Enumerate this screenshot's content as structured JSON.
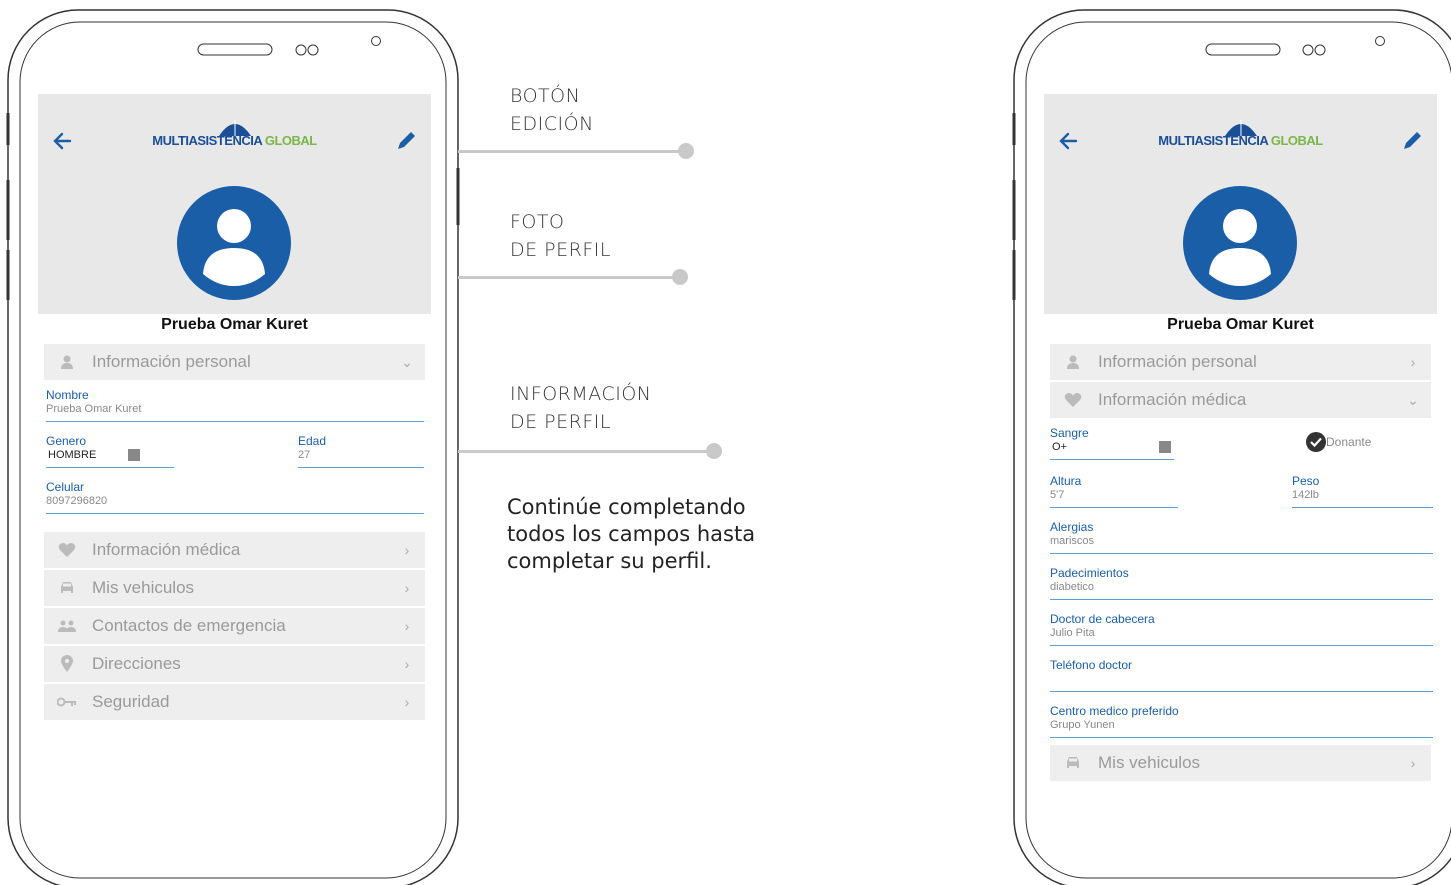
{
  "colors": {
    "brand_blue": "#1a5ea8",
    "brand_green": "#7ab648",
    "menu_bg": "#eeeeee",
    "header_bg": "#e8e8e8",
    "field_line": "#5aa0d8"
  },
  "logo": {
    "part1": "MULTIASISTENCIA",
    "part2": " GLOBAL"
  },
  "callouts": {
    "edit": [
      "BOTÓN",
      "EDICIÓN"
    ],
    "photo": [
      "FOTO",
      "DE PERFIL"
    ],
    "info": [
      "INFORMACIÓN",
      "DE PERFIL"
    ],
    "description": "Continúe completando todos los campos hasta completar su perfil."
  },
  "left_screen": {
    "profile_name": "Prueba Omar Kuret",
    "personal_section": {
      "icon": "person-icon",
      "label": "Información personal",
      "chevron": "chevron-down-icon"
    },
    "fields": {
      "nombre": {
        "label": "Nombre",
        "value": "Prueba Omar Kuret"
      },
      "genero": {
        "label": "Genero",
        "value": "HOMBRE"
      },
      "edad": {
        "label": "Edad",
        "value": "27"
      },
      "celular": {
        "label": "Celular",
        "value": "8097296820"
      }
    },
    "menu": [
      {
        "icon": "heart-icon",
        "label": "Información médica"
      },
      {
        "icon": "car-icon",
        "label": "Mis vehiculos"
      },
      {
        "icon": "people-icon",
        "label": "Contactos de emergencia"
      },
      {
        "icon": "location-pin-icon",
        "label": "Direcciones"
      },
      {
        "icon": "key-icon",
        "label": "Seguridad"
      }
    ]
  },
  "right_screen": {
    "profile_name": "Prueba Omar Kuret",
    "personal_section": {
      "icon": "person-icon",
      "label": "Información personal"
    },
    "medical_section": {
      "icon": "heart-icon",
      "label": "Información médica"
    },
    "fields": {
      "sangre": {
        "label": "Sangre",
        "value": "O+"
      },
      "donante": {
        "label": "Donante"
      },
      "altura": {
        "label": "Altura",
        "value": "5'7"
      },
      "peso": {
        "label": "Peso",
        "value": "142lb"
      },
      "alergias": {
        "label": "Alergias",
        "value": "mariscos"
      },
      "padecimientos": {
        "label": "Padecimientos",
        "value": "diabetico"
      },
      "doctor": {
        "label": "Doctor de cabecera",
        "value": "Julio Pita"
      },
      "telefono": {
        "label": "Teléfono doctor",
        "value": ""
      },
      "centro": {
        "label": "Centro medico preferido",
        "value": "Grupo Yunen"
      }
    },
    "vehicles_section": {
      "icon": "car-icon",
      "label": "Mis vehiculos"
    }
  }
}
